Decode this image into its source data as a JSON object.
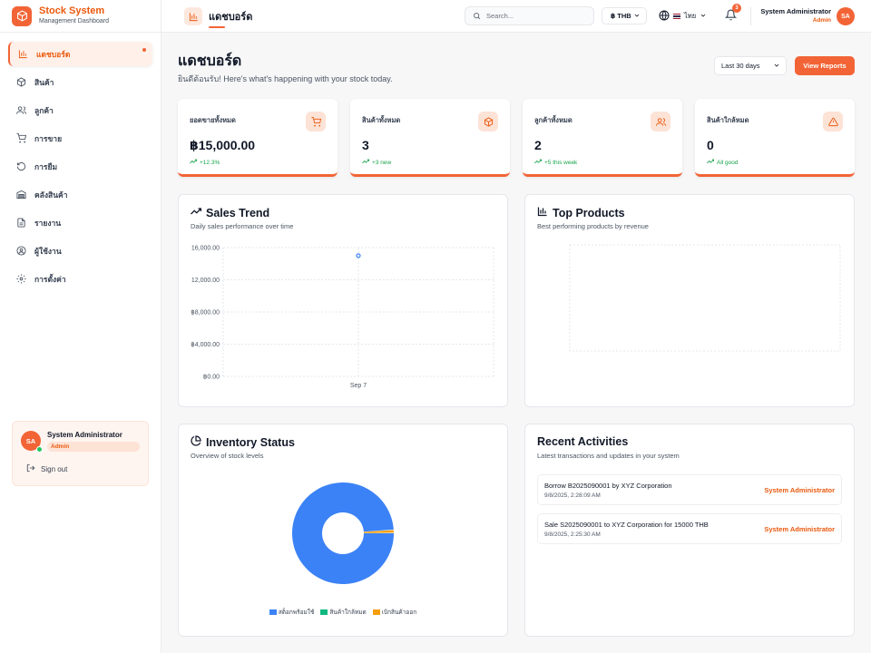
{
  "app": {
    "title": "Stock System",
    "subtitle": "Management Dashboard"
  },
  "sidebar": {
    "items": [
      {
        "label": "แดชบอร์ด",
        "icon": "bar-chart-icon",
        "active": true
      },
      {
        "label": "สินค้า",
        "icon": "box-icon"
      },
      {
        "label": "ลูกค้า",
        "icon": "users-icon"
      },
      {
        "label": "การขาย",
        "icon": "cart-icon"
      },
      {
        "label": "การยืม",
        "icon": "rotate-icon"
      },
      {
        "label": "คลังสินค้า",
        "icon": "warehouse-icon"
      },
      {
        "label": "รายงาน",
        "icon": "file-icon"
      },
      {
        "label": "ผู้ใช้งาน",
        "icon": "user-circle-icon"
      },
      {
        "label": "การตั้งค่า",
        "icon": "gear-icon"
      }
    ],
    "profile": {
      "initials": "SA",
      "name": "System Administrator",
      "role": "Admin",
      "signout": "Sign out"
    }
  },
  "topbar": {
    "title": "แดชบอร์ด",
    "search_placeholder": "Search...",
    "currency": "฿ THB",
    "language": "ไทย",
    "notifications": "3",
    "user_name": "System Administrator",
    "user_role": "Admin",
    "user_initials": "SA"
  },
  "header": {
    "title": "แดชบอร์ด",
    "subtitle": "ยินดีต้อนรับ! Here's what's happening with your stock today.",
    "range": "Last 30 days",
    "view_reports": "View Reports"
  },
  "stats": [
    {
      "label": "ยอดขายทั้งหมด",
      "value": "฿15,000.00",
      "trend": "+12.3%",
      "icon": "cart-icon"
    },
    {
      "label": "สินค้าทั้งหมด",
      "value": "3",
      "trend": "+3 new",
      "icon": "box-icon"
    },
    {
      "label": "ลูกค้าทั้งหมด",
      "value": "2",
      "trend": "+5 this week",
      "icon": "users-icon"
    },
    {
      "label": "สินค้าใกล้หมด",
      "value": "0",
      "trend": "All good",
      "icon": "warning-icon"
    }
  ],
  "sales_trend": {
    "title": "Sales Trend",
    "subtitle": "Daily sales performance over time"
  },
  "top_products": {
    "title": "Top Products",
    "subtitle": "Best performing products by revenue"
  },
  "inventory": {
    "title": "Inventory Status",
    "subtitle": "Overview of stock levels",
    "legend": [
      {
        "label": "สต็อกพร้อมใช้",
        "color": "#3b82f6"
      },
      {
        "label": "สินค้าใกล้หมด",
        "color": "#10b981"
      },
      {
        "label": "เบิกสินค้าออก",
        "color": "#f59e0b"
      }
    ]
  },
  "activities": {
    "title": "Recent Activities",
    "subtitle": "Latest transactions and updates in your system",
    "items": [
      {
        "title": "Borrow B2025090001 by XYZ Corporation",
        "time": "9/8/2025, 2:28:09 AM",
        "user": "System Administrator"
      },
      {
        "title": "Sale S2025090001 to XYZ Corporation for 15000 THB",
        "time": "9/8/2025, 2:25:30 AM",
        "user": "System Administrator"
      }
    ]
  },
  "chart_data": [
    {
      "type": "line",
      "x": [
        "Sep 7"
      ],
      "series": [
        {
          "values": [
            15000
          ]
        }
      ],
      "yticks": [
        "฿0.00",
        "฿4,000.00",
        "฿8,000.00",
        "12,000.00",
        "16,000.00"
      ],
      "ylim": [
        0,
        16000
      ],
      "grid": true
    },
    {
      "type": "pie",
      "categories": [
        "สต็อกพร้อมใช้",
        "สินค้าใกล้หมด",
        "เบิกสินค้าออก"
      ],
      "values": [
        99,
        0,
        1
      ],
      "legend": "bottom"
    }
  ]
}
